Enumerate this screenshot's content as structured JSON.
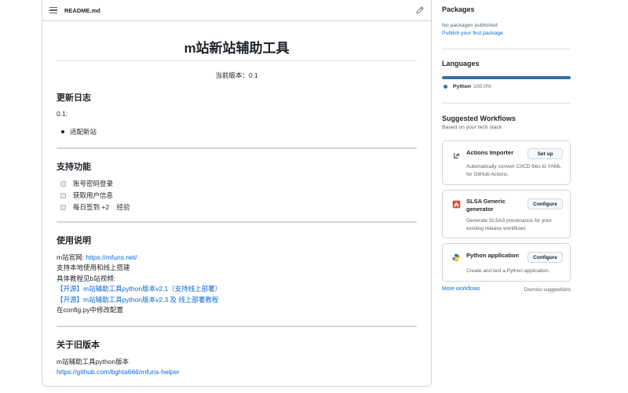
{
  "readme": {
    "filename": "README.md",
    "title": "m站新站辅助工具",
    "version_text": "当前版本：0.1",
    "changelog": {
      "heading": "更新日志",
      "version": "0.1:",
      "items": [
        "适配新站"
      ]
    },
    "features": {
      "heading": "支持功能",
      "tasks": [
        "账号密码登录",
        "获取用户信息",
        "每日签到 +2    经验"
      ]
    },
    "usage": {
      "heading": "使用说明",
      "site_prefix": "m站官网: ",
      "site_link": "https://mfuns.net/",
      "line2": "支持本地使用和线上搭建",
      "line3": "具体教程见b站视频:",
      "video1": "【开源】m站辅助工具python版本v2.1（支持线上部署）",
      "video2": "【开源】m站辅助工具python版本v2.3 及 线上部署教程",
      "line6": "在config.py中修改配置"
    },
    "old": {
      "heading": "关于旧版本",
      "line1": "m站辅助工具python版本",
      "link": "https://github.com/bghta666/mfuns-helper"
    }
  },
  "sidebar": {
    "packages": {
      "heading": "Packages",
      "empty": "No packages published",
      "link": "Publish your first package"
    },
    "languages": {
      "heading": "Languages",
      "items": [
        {
          "name": "Python",
          "percent": "100.0%",
          "fraction": 1.0,
          "color": "#3572A5"
        }
      ]
    },
    "workflows": {
      "heading": "Suggested Workflows",
      "subheading": "Based on your tech stack",
      "cards": [
        {
          "title": "Actions Importer",
          "button": "Set up",
          "description": "Automatically convert CI/CD files to YAML for GitHub Actions.",
          "icon": "actions-importer-icon"
        },
        {
          "title": "SLSA Generic generator",
          "button": "Configure",
          "description": "Generate SLSA3 provenance for your existing release workflows",
          "icon": "slsa-icon"
        },
        {
          "title": "Python application",
          "button": "Configure",
          "description": "Create and test a Python application.",
          "icon": "python-icon"
        }
      ],
      "more": "More workflows",
      "dismiss": "Dismiss suggestions"
    }
  }
}
